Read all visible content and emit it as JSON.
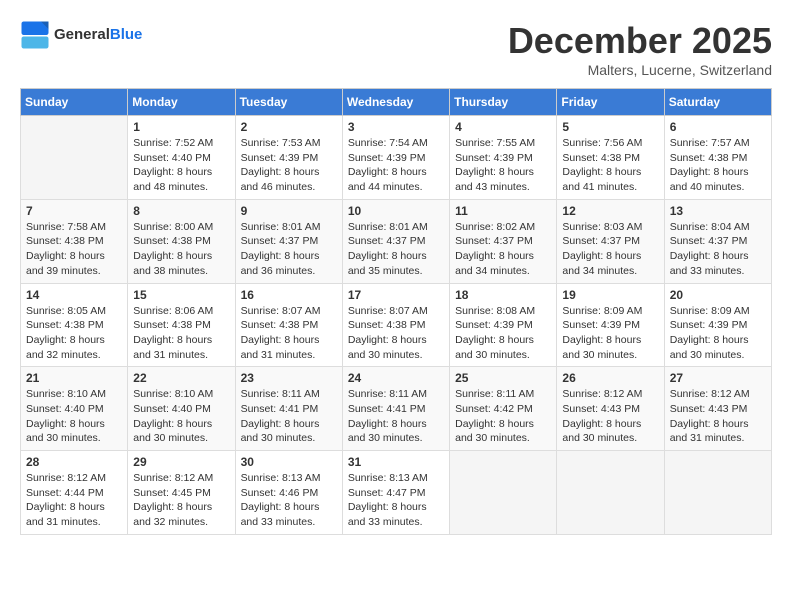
{
  "header": {
    "logo_general": "General",
    "logo_blue": "Blue",
    "month": "December 2025",
    "location": "Malters, Lucerne, Switzerland"
  },
  "days_of_week": [
    "Sunday",
    "Monday",
    "Tuesday",
    "Wednesday",
    "Thursday",
    "Friday",
    "Saturday"
  ],
  "weeks": [
    [
      {
        "day": "",
        "empty": true
      },
      {
        "day": "1",
        "sunrise": "7:52 AM",
        "sunset": "4:40 PM",
        "daylight": "8 hours and 48 minutes."
      },
      {
        "day": "2",
        "sunrise": "7:53 AM",
        "sunset": "4:39 PM",
        "daylight": "8 hours and 46 minutes."
      },
      {
        "day": "3",
        "sunrise": "7:54 AM",
        "sunset": "4:39 PM",
        "daylight": "8 hours and 44 minutes."
      },
      {
        "day": "4",
        "sunrise": "7:55 AM",
        "sunset": "4:39 PM",
        "daylight": "8 hours and 43 minutes."
      },
      {
        "day": "5",
        "sunrise": "7:56 AM",
        "sunset": "4:38 PM",
        "daylight": "8 hours and 41 minutes."
      },
      {
        "day": "6",
        "sunrise": "7:57 AM",
        "sunset": "4:38 PM",
        "daylight": "8 hours and 40 minutes."
      }
    ],
    [
      {
        "day": "7",
        "sunrise": "7:58 AM",
        "sunset": "4:38 PM",
        "daylight": "8 hours and 39 minutes."
      },
      {
        "day": "8",
        "sunrise": "8:00 AM",
        "sunset": "4:38 PM",
        "daylight": "8 hours and 38 minutes."
      },
      {
        "day": "9",
        "sunrise": "8:01 AM",
        "sunset": "4:37 PM",
        "daylight": "8 hours and 36 minutes."
      },
      {
        "day": "10",
        "sunrise": "8:01 AM",
        "sunset": "4:37 PM",
        "daylight": "8 hours and 35 minutes."
      },
      {
        "day": "11",
        "sunrise": "8:02 AM",
        "sunset": "4:37 PM",
        "daylight": "8 hours and 34 minutes."
      },
      {
        "day": "12",
        "sunrise": "8:03 AM",
        "sunset": "4:37 PM",
        "daylight": "8 hours and 34 minutes."
      },
      {
        "day": "13",
        "sunrise": "8:04 AM",
        "sunset": "4:37 PM",
        "daylight": "8 hours and 33 minutes."
      }
    ],
    [
      {
        "day": "14",
        "sunrise": "8:05 AM",
        "sunset": "4:38 PM",
        "daylight": "8 hours and 32 minutes."
      },
      {
        "day": "15",
        "sunrise": "8:06 AM",
        "sunset": "4:38 PM",
        "daylight": "8 hours and 31 minutes."
      },
      {
        "day": "16",
        "sunrise": "8:07 AM",
        "sunset": "4:38 PM",
        "daylight": "8 hours and 31 minutes."
      },
      {
        "day": "17",
        "sunrise": "8:07 AM",
        "sunset": "4:38 PM",
        "daylight": "8 hours and 30 minutes."
      },
      {
        "day": "18",
        "sunrise": "8:08 AM",
        "sunset": "4:39 PM",
        "daylight": "8 hours and 30 minutes."
      },
      {
        "day": "19",
        "sunrise": "8:09 AM",
        "sunset": "4:39 PM",
        "daylight": "8 hours and 30 minutes."
      },
      {
        "day": "20",
        "sunrise": "8:09 AM",
        "sunset": "4:39 PM",
        "daylight": "8 hours and 30 minutes."
      }
    ],
    [
      {
        "day": "21",
        "sunrise": "8:10 AM",
        "sunset": "4:40 PM",
        "daylight": "8 hours and 30 minutes."
      },
      {
        "day": "22",
        "sunrise": "8:10 AM",
        "sunset": "4:40 PM",
        "daylight": "8 hours and 30 minutes."
      },
      {
        "day": "23",
        "sunrise": "8:11 AM",
        "sunset": "4:41 PM",
        "daylight": "8 hours and 30 minutes."
      },
      {
        "day": "24",
        "sunrise": "8:11 AM",
        "sunset": "4:41 PM",
        "daylight": "8 hours and 30 minutes."
      },
      {
        "day": "25",
        "sunrise": "8:11 AM",
        "sunset": "4:42 PM",
        "daylight": "8 hours and 30 minutes."
      },
      {
        "day": "26",
        "sunrise": "8:12 AM",
        "sunset": "4:43 PM",
        "daylight": "8 hours and 30 minutes."
      },
      {
        "day": "27",
        "sunrise": "8:12 AM",
        "sunset": "4:43 PM",
        "daylight": "8 hours and 31 minutes."
      }
    ],
    [
      {
        "day": "28",
        "sunrise": "8:12 AM",
        "sunset": "4:44 PM",
        "daylight": "8 hours and 31 minutes."
      },
      {
        "day": "29",
        "sunrise": "8:12 AM",
        "sunset": "4:45 PM",
        "daylight": "8 hours and 32 minutes."
      },
      {
        "day": "30",
        "sunrise": "8:13 AM",
        "sunset": "4:46 PM",
        "daylight": "8 hours and 33 minutes."
      },
      {
        "day": "31",
        "sunrise": "8:13 AM",
        "sunset": "4:47 PM",
        "daylight": "8 hours and 33 minutes."
      },
      {
        "day": "",
        "empty": true
      },
      {
        "day": "",
        "empty": true
      },
      {
        "day": "",
        "empty": true
      }
    ]
  ],
  "labels": {
    "sunrise": "Sunrise:",
    "sunset": "Sunset:",
    "daylight": "Daylight:"
  }
}
